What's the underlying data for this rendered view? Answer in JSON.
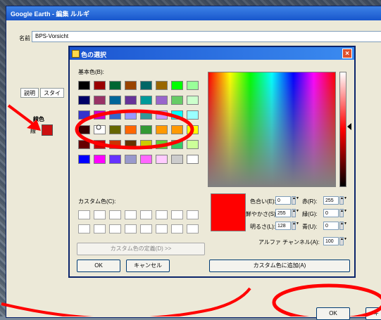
{
  "window": {
    "title": "Google Earth - 編集 ルルギ",
    "name_label": "名前",
    "name_value": "BPS-Vorsicht",
    "tabs": [
      "説明",
      "スタイ"
    ],
    "section_label": "線色",
    "sub_label": "線"
  },
  "dialog": {
    "title": "色の選択",
    "close_glyph": "×",
    "basic_colors_label": "基本色(B):",
    "basic_colors": [
      "#000000",
      "#990000",
      "#006633",
      "#994400",
      "#006666",
      "#996600",
      "#00ff00",
      "#99ff99",
      "#000066",
      "#993366",
      "#006699",
      "#663399",
      "#009999",
      "#9966cc",
      "#66cc66",
      "#ccffcc",
      "#3333cc",
      "#cc00cc",
      "#3366cc",
      "#9999ff",
      "#339999",
      "#cc99ff",
      "#00ffff",
      "#99ffff",
      "#330000",
      "#ffffff",
      "#666600",
      "#ff6600",
      "#339933",
      "#ff9900",
      "#ff9900",
      "#ffff00",
      "#660000",
      "#cc0000",
      "#cc3300",
      "#663300",
      "#cccc00",
      "#66cc33",
      "#33cc66",
      "#ccff99",
      "#0000ff",
      "#ff00ff",
      "#6633ff",
      "#9999cc",
      "#ff66ff",
      "#ffccff",
      "#cccccc",
      "#ffffff"
    ],
    "custom_colors_label": "カスタム色(C):",
    "define_custom_button": "カスタム色の定義(D) >>",
    "ok_button": "OK",
    "cancel_button": "キャンセル",
    "add_custom_button": "カスタム色に追加(A)",
    "preview_color": "#ff0000",
    "fields": {
      "hue_label": "色合い(E):",
      "hue_value": "0",
      "sat_label": "鮮やかさ(S):",
      "sat_value": "255",
      "lum_label": "明るさ(L):",
      "lum_value": "128",
      "red_label": "赤(R):",
      "red_value": "255",
      "green_label": "緑(G):",
      "green_value": "0",
      "blue_label": "青(U):",
      "blue_value": "0",
      "alpha_label": "アルファ チャンネル(A):",
      "alpha_value": "100"
    }
  },
  "main_buttons": {
    "ok": "OK",
    "cancel": "キ"
  },
  "colors": {
    "annotation_red": "#ff0000",
    "titlebar_blue": "#1856cc"
  }
}
